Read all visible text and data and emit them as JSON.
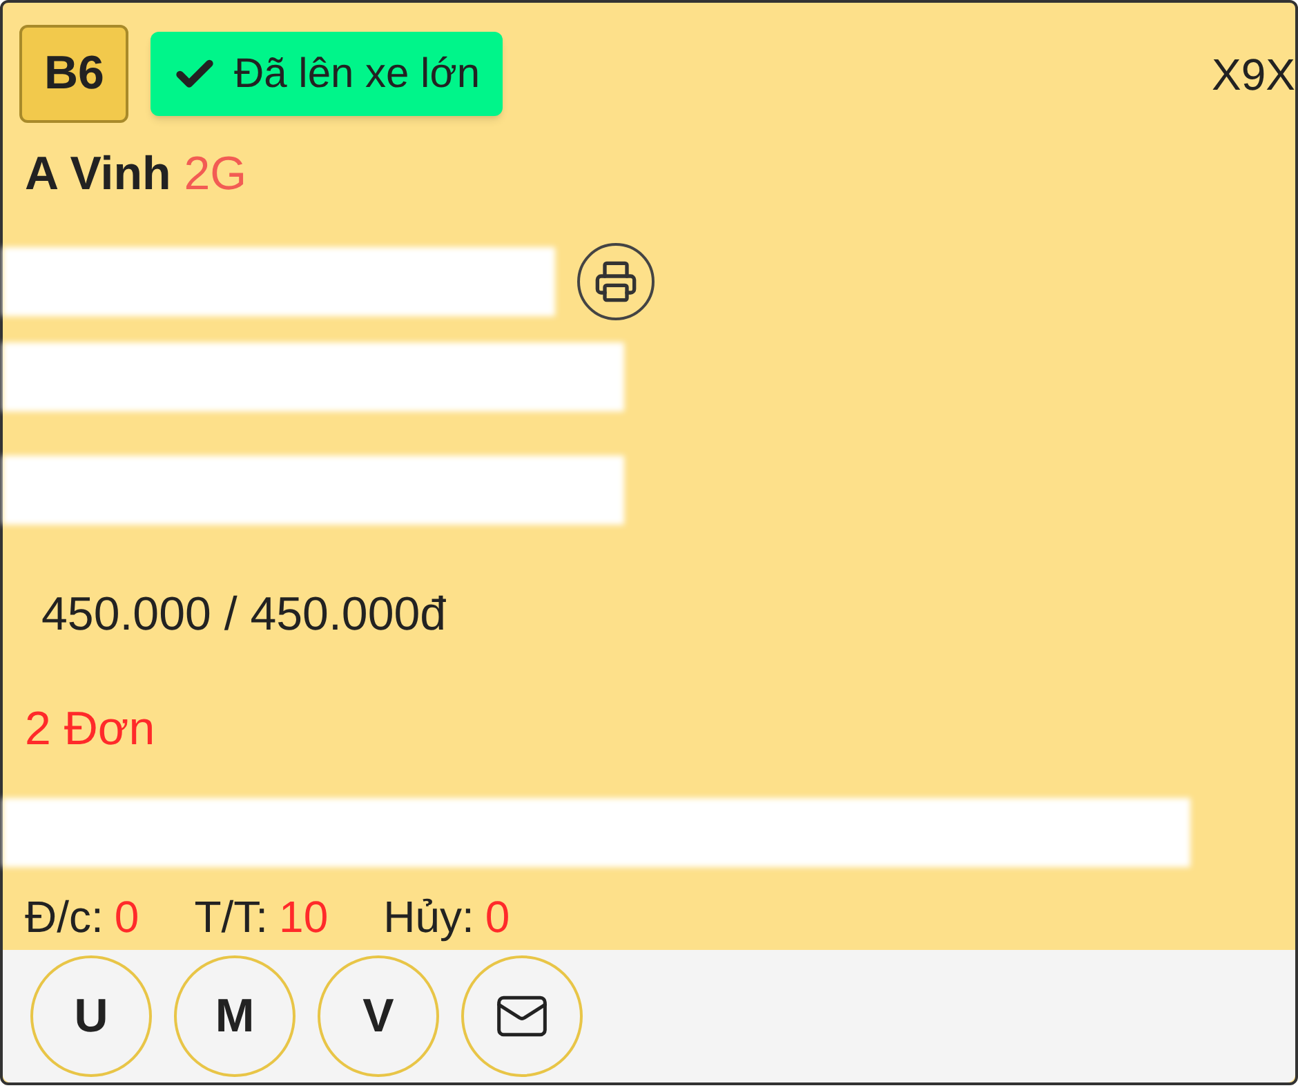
{
  "card": {
    "slot": "B6",
    "status": {
      "label": "Đã lên xe lớn",
      "done": true
    },
    "code": "X9X",
    "customer": {
      "name": "A Vinh",
      "tag": "2G"
    },
    "price": "450.000 / 450.000đ",
    "orders": "2 Đơn",
    "stats": [
      {
        "label": "Đ/c:",
        "value": "0"
      },
      {
        "label": "T/T:",
        "value": "10"
      },
      {
        "label": "Hủy:",
        "value": "0"
      }
    ]
  },
  "footer_buttons": [
    {
      "kind": "letter",
      "label": "U"
    },
    {
      "kind": "letter",
      "label": "M"
    },
    {
      "kind": "letter",
      "label": "V"
    },
    {
      "kind": "mail"
    }
  ]
}
